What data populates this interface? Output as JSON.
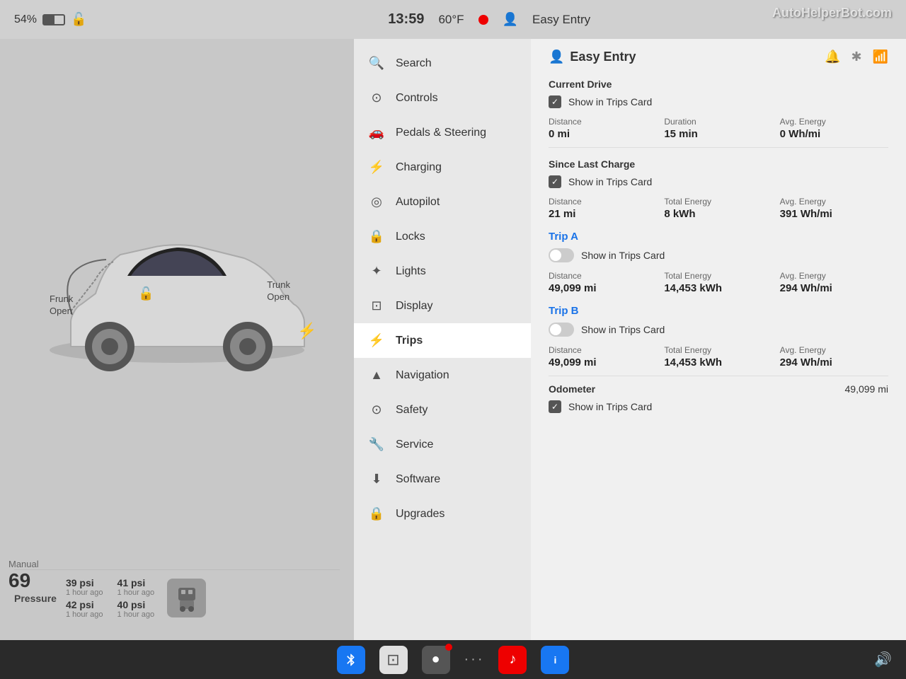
{
  "watermark": "AutoHelperBot.com",
  "statusBar": {
    "battery": "54%",
    "time": "13:59",
    "temperature": "60°F",
    "profile": "Easy Entry"
  },
  "leftPanel": {
    "frunkLabel": "Frunk\nOpen",
    "trunkLabel": "Trunk\nOpen",
    "tirePressure": {
      "label": "Pressure",
      "topLeft": "39 psi",
      "topLeftTime": "1 hour ago",
      "topRight": "41 psi",
      "topRightTime": "1 hour ago",
      "bottomLeft": "42 psi",
      "bottomLeftTime": "1 hour ago",
      "bottomRight": "40 psi",
      "bottomRightTime": "1 hour ago"
    },
    "manualLabel": "Manual",
    "manualNumber": "69"
  },
  "menu": {
    "items": [
      {
        "id": "search",
        "label": "Search",
        "icon": "🔍"
      },
      {
        "id": "controls",
        "label": "Controls",
        "icon": "⊙"
      },
      {
        "id": "pedals",
        "label": "Pedals & Steering",
        "icon": "🚗"
      },
      {
        "id": "charging",
        "label": "Charging",
        "icon": "⚡"
      },
      {
        "id": "autopilot",
        "label": "Autopilot",
        "icon": "⊕"
      },
      {
        "id": "locks",
        "label": "Locks",
        "icon": "🔒"
      },
      {
        "id": "lights",
        "label": "Lights",
        "icon": "✦"
      },
      {
        "id": "display",
        "label": "Display",
        "icon": "⊡"
      },
      {
        "id": "trips",
        "label": "Trips",
        "icon": "⚡",
        "active": true
      },
      {
        "id": "navigation",
        "label": "Navigation",
        "icon": "▲"
      },
      {
        "id": "safety",
        "label": "Safety",
        "icon": "⊙"
      },
      {
        "id": "service",
        "label": "Service",
        "icon": "🔧"
      },
      {
        "id": "software",
        "label": "Software",
        "icon": "⬇"
      },
      {
        "id": "upgrades",
        "label": "Upgrades",
        "icon": "🔒"
      }
    ]
  },
  "tripsPanel": {
    "title": "Easy Entry",
    "currentDrive": {
      "sectionTitle": "Current Drive",
      "showTripsCard": true,
      "showLabel": "Show in Trips Card",
      "distance": {
        "label": "Distance",
        "value": "0 mi"
      },
      "duration": {
        "label": "Duration",
        "value": "15 min"
      },
      "avgEnergy": {
        "label": "Avg. Energy",
        "value": "0 Wh/mi"
      }
    },
    "sinceLastCharge": {
      "sectionTitle": "Since Last Charge",
      "showTripsCard": true,
      "showLabel": "Show in Trips Card",
      "distance": {
        "label": "Distance",
        "value": "21 mi"
      },
      "totalEnergy": {
        "label": "Total Energy",
        "value": "8 kWh"
      },
      "avgEnergy": {
        "label": "Avg. Energy",
        "value": "391 Wh/mi"
      }
    },
    "tripA": {
      "title": "Trip A",
      "showTripsCard": false,
      "showLabel": "Show in Trips Card",
      "distance": {
        "label": "Distance",
        "value": "49,099 mi"
      },
      "totalEnergy": {
        "label": "Total Energy",
        "value": "14,453 kWh"
      },
      "avgEnergy": {
        "label": "Avg. Energy",
        "value": "294 Wh/mi"
      }
    },
    "tripB": {
      "title": "Trip B",
      "showTripsCard": false,
      "showLabel": "Show in Trips Card",
      "distance": {
        "label": "Distance",
        "value": "49,099 mi"
      },
      "totalEnergy": {
        "label": "Total Energy",
        "value": "14,453 kWh"
      },
      "avgEnergy": {
        "label": "Avg. Energy",
        "value": "294 Wh/mi"
      }
    },
    "odometer": {
      "label": "Odometer",
      "showLabel": "Show in Trips Card",
      "value": "49,099 mi",
      "showTripsCard": true
    }
  },
  "taskbar": {
    "items": [
      {
        "id": "bluetooth",
        "label": "BT",
        "type": "blue"
      },
      {
        "id": "finder",
        "label": "⊡",
        "type": "white"
      },
      {
        "id": "camera",
        "label": "●",
        "type": "dark"
      },
      {
        "id": "music",
        "label": "♪",
        "type": "red"
      },
      {
        "id": "info",
        "label": "i",
        "type": "blue-info"
      }
    ]
  }
}
